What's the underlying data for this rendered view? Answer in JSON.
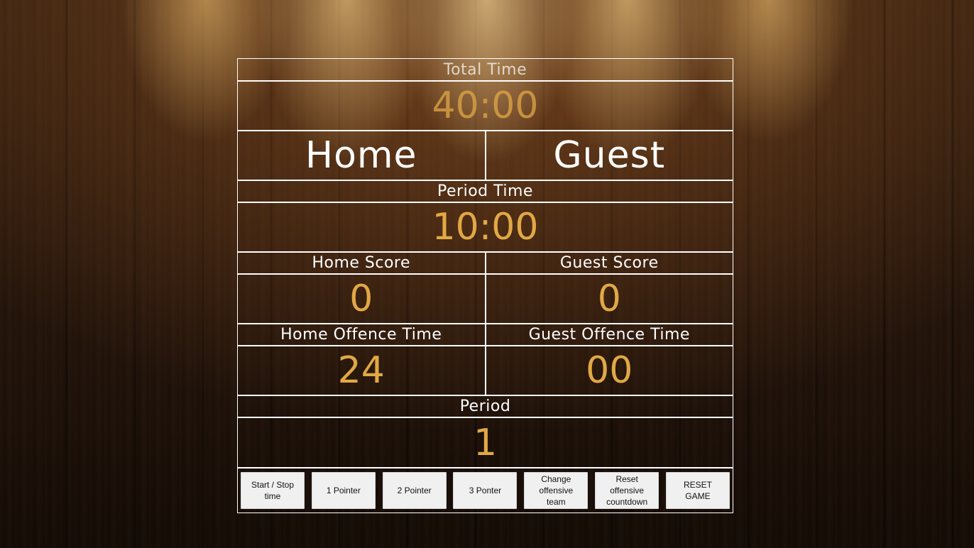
{
  "total_time": {
    "label": "Total Time",
    "value": "40:00"
  },
  "teams": {
    "home": "Home",
    "guest": "Guest"
  },
  "period_time": {
    "label": "Period Time",
    "value": "10:00"
  },
  "scores": {
    "home_label": "Home Score",
    "home_value": "0",
    "guest_label": "Guest Score",
    "guest_value": "0"
  },
  "offence": {
    "home_label": "Home Offence Time",
    "home_value": "24",
    "guest_label": "Guest Offence Time",
    "guest_value": "00"
  },
  "period": {
    "label": "Period",
    "value": "1"
  },
  "controls": {
    "start_stop": "Start / Stop time",
    "one_pointer": "1 Pointer",
    "two_pointer": "2 Pointer",
    "three_pointer": "3 Ponter",
    "change_offensive": "Change offensive team",
    "reset_offensive": "Reset offensive countdown",
    "reset_game": "RESET GAME"
  },
  "colors": {
    "value_gold": "#e1a845",
    "grid_lines": "#ffffff",
    "button_bg": "#f0f0f0"
  }
}
